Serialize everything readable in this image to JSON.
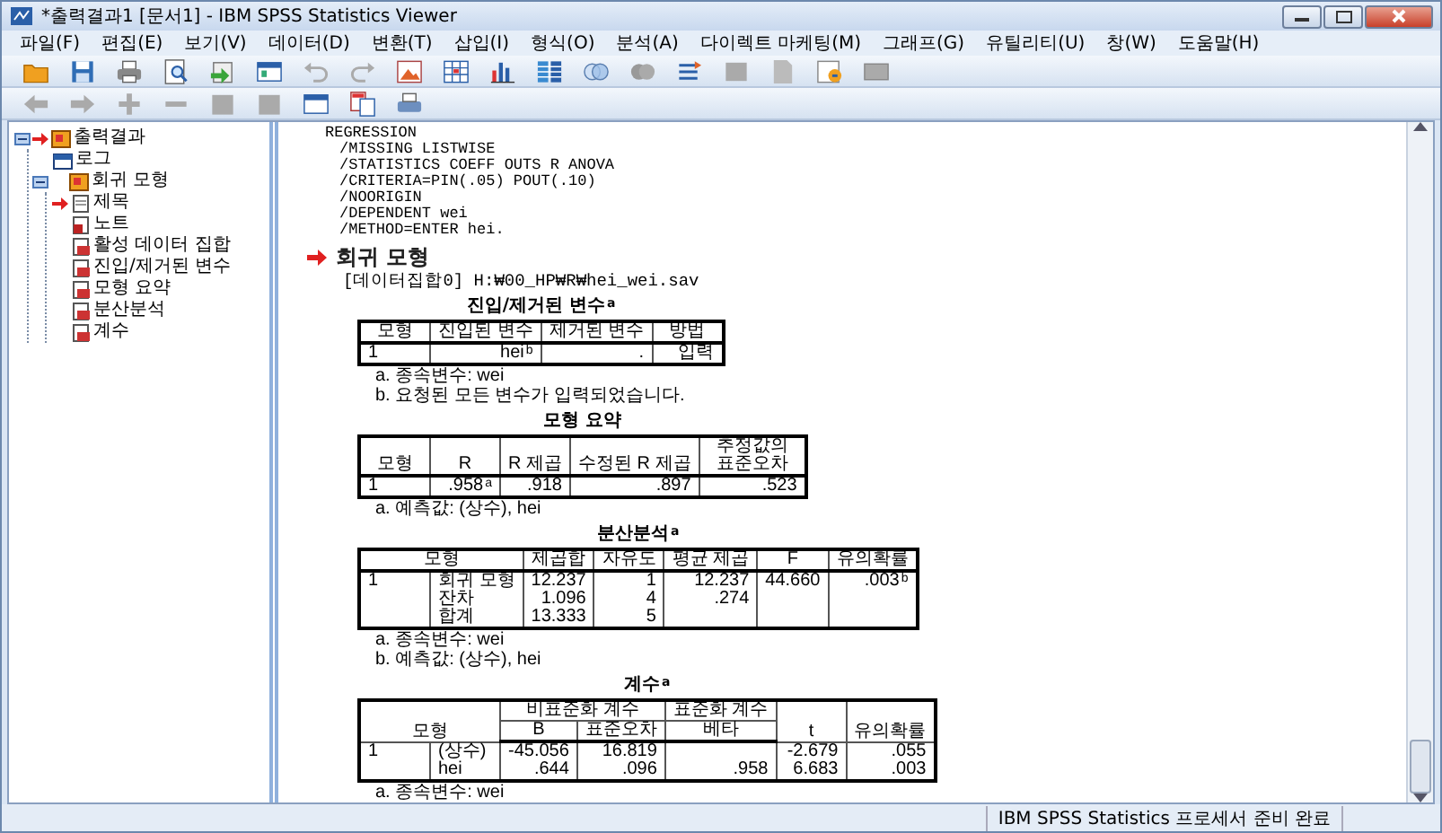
{
  "window": {
    "title": "*출력결과1 [문서1] - IBM SPSS Statistics Viewer"
  },
  "menu": [
    "파일(F)",
    "편집(E)",
    "보기(V)",
    "데이터(D)",
    "변환(T)",
    "삽입(I)",
    "형식(O)",
    "분석(A)",
    "다이렉트 마케팅(M)",
    "그래프(G)",
    "유틸리티(U)",
    "창(W)",
    "도움말(H)"
  ],
  "tree": {
    "items": [
      {
        "label": "출력결과",
        "kind": "book",
        "marked": true,
        "expanded": true,
        "children": [
          {
            "label": "로그",
            "kind": "log",
            "marked": false
          },
          {
            "label": "회귀 모형",
            "kind": "book",
            "marked": false,
            "expanded": true,
            "children": [
              {
                "label": "제목",
                "kind": "title",
                "marked": true
              },
              {
                "label": "노트",
                "kind": "note",
                "marked": false
              },
              {
                "label": "활성 데이터 집합",
                "kind": "table",
                "marked": false
              },
              {
                "label": "진입/제거된 변수",
                "kind": "table",
                "marked": false
              },
              {
                "label": "모형 요약",
                "kind": "table",
                "marked": false
              },
              {
                "label": "분산분석",
                "kind": "table",
                "marked": false
              },
              {
                "label": "계수",
                "kind": "table",
                "marked": false
              }
            ]
          }
        ]
      }
    ]
  },
  "output": {
    "syntax": [
      "REGRESSION",
      "/MISSING LISTWISE",
      "/STATISTICS COEFF OUTS R ANOVA",
      "/CRITERIA=PIN(.05) POUT(.10)",
      "/NOORIGIN",
      "/DEPENDENT wei",
      "/METHOD=ENTER hei."
    ],
    "heading": {
      "text": "회귀 모형",
      "marked": true
    },
    "dataset": "[데이터집합0] H:₩00_HP₩R₩hei_wei.sav",
    "tables": [
      {
        "title": "진입/제거된 변수$^{a}$",
        "header_rows": [
          [
            {
              "text": "모형"
            },
            {
              "text": "진입된 변수"
            },
            {
              "text": "제거된 변수"
            },
            {
              "text": "방법"
            }
          ]
        ],
        "rows": [
          [
            "1",
            "hei$^{b}$",
            ".",
            "입력"
          ]
        ],
        "footnotes": [
          "a. 종속변수: wei",
          "b. 요청된 모든 변수가 입력되었습니다."
        ]
      },
      {
        "title": "모형 요약",
        "header_rows": [
          [
            {
              "text": "모형"
            },
            {
              "text": "R"
            },
            {
              "text": "R 제곱"
            },
            {
              "text": "수정된 R 제곱"
            },
            {
              "text": "추정값의 표준오차"
            }
          ]
        ],
        "rows": [
          [
            "1",
            ".958$^{a}$",
            ".918",
            ".897",
            ".523"
          ]
        ],
        "footnotes": [
          "a. 예측값: (상수), hei"
        ]
      },
      {
        "title": "분산분석$^{a}$",
        "header_rows": [
          [
            {
              "text": "모형",
              "colspan": 2
            },
            {
              "text": "제곱합"
            },
            {
              "text": "자유도"
            },
            {
              "text": "평균 제곱"
            },
            {
              "text": "F"
            },
            {
              "text": "유의확률"
            }
          ]
        ],
        "rows": [
          [
            "1",
            "회귀 모형",
            "12.237",
            "1",
            "12.237",
            "44.660",
            ".003$^{b}$"
          ],
          [
            null,
            "잔차",
            "1.096",
            "4",
            ".274",
            null,
            null
          ],
          [
            null,
            "합계",
            "13.333",
            "5",
            null,
            null,
            null
          ]
        ],
        "footnotes": [
          "a. 종속변수: wei",
          "b. 예측값: (상수), hei"
        ]
      },
      {
        "title": "계수$^{a}$",
        "header_rows": [
          [
            {
              "text": "모형",
              "colspan": 2,
              "rowspan": 2
            },
            {
              "text": "비표준화 계수",
              "colspan": 2
            },
            {
              "text": "표준화 계수"
            },
            {
              "text": "t",
              "rowspan": 2
            },
            {
              "text": "유의확률",
              "rowspan": 2
            }
          ],
          [
            {
              "text": "B"
            },
            {
              "text": "표준오차"
            },
            {
              "text": "베타"
            }
          ]
        ],
        "rows": [
          [
            "1",
            "(상수)",
            "-45.056",
            "16.819",
            null,
            "-2.679",
            ".055"
          ],
          [
            null,
            "hei",
            ".644",
            ".096",
            ".958",
            "6.683",
            ".003"
          ]
        ],
        "footnotes": [
          "a. 종속변수: wei"
        ]
      }
    ]
  },
  "status_bar": {
    "text": "IBM SPSS Statistics 프로세서 준비 완료"
  }
}
